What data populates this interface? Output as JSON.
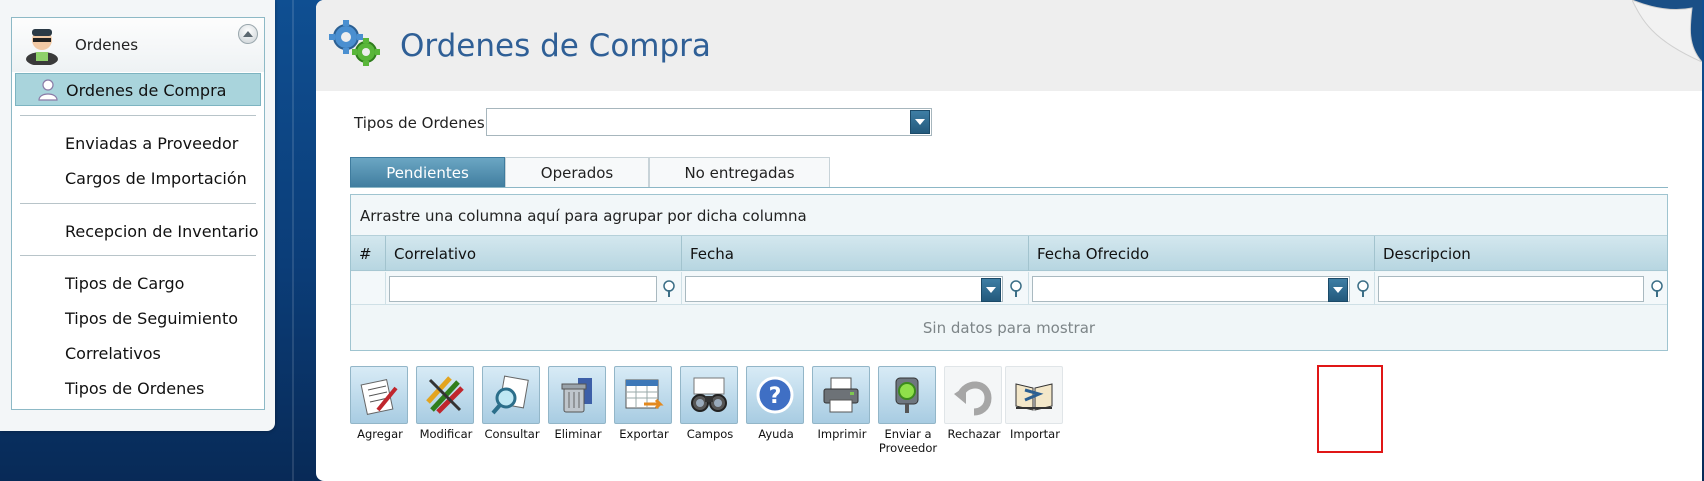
{
  "sidebar": {
    "title": "Ordenes",
    "active_item": "Ordenes de Compra",
    "groups": [
      [
        "Enviadas a Proveedor",
        "Cargos de Importación"
      ],
      [
        "Recepcion de Inventario"
      ],
      [
        "Tipos de Cargo",
        "Tipos de Seguimiento",
        "Correlativos",
        "Tipos de Ordenes"
      ]
    ]
  },
  "header": {
    "title": "Ordenes de Compra"
  },
  "filter": {
    "label": "Tipos de Ordenes",
    "value": ""
  },
  "tabs": [
    {
      "label": "Pendientes",
      "active": true
    },
    {
      "label": "Operados",
      "active": false
    },
    {
      "label": "No entregadas",
      "active": false
    }
  ],
  "grid": {
    "group_hint": "Arrastre una columna aquí para agrupar por dicha columna",
    "columns": [
      "#",
      "Correlativo",
      "Fecha",
      "Fecha Ofrecido",
      "Descripcion"
    ],
    "empty_text": "Sin datos para mostrar"
  },
  "toolbar": {
    "buttons": [
      {
        "label": "Agregar",
        "icon": "edit-document-icon"
      },
      {
        "label": "Modificar",
        "icon": "pencils-icon"
      },
      {
        "label": "Consultar",
        "icon": "magnifier-document-icon"
      },
      {
        "label": "Eliminar",
        "icon": "trash-can-icon"
      },
      {
        "label": "Exportar",
        "icon": "spreadsheet-export-icon"
      },
      {
        "label": "Campos",
        "icon": "binoculars-icon"
      },
      {
        "label": "Ayuda",
        "icon": "help-icon"
      },
      {
        "label": "Imprimir",
        "icon": "printer-icon"
      },
      {
        "label": "Enviar a Proveedor",
        "icon": "traffic-signal-icon"
      },
      {
        "label": "Rechazar",
        "icon": "undo-arrow-icon"
      },
      {
        "label": "Importar",
        "icon": "import-book-icon"
      }
    ],
    "highlighted": "Importar"
  },
  "colors": {
    "title_blue": "#2f5f96",
    "active_item_bg": "#a9d4dc",
    "tab_active": "#3f7c9e",
    "highlight_border": "#e01616"
  }
}
